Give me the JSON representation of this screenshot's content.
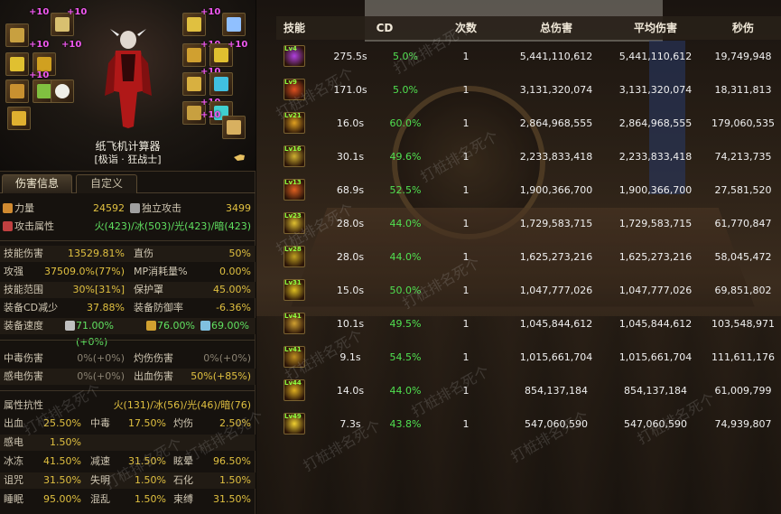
{
  "character": {
    "name": "纸飞机计算器",
    "title": "[极诣 · 狂战士]",
    "enhance_label": "+10"
  },
  "tabs": [
    {
      "label": "伤害信息",
      "active": true
    },
    {
      "label": "自定义",
      "active": false
    }
  ],
  "stats_top": {
    "strength": {
      "label": "力量",
      "value": "24592"
    },
    "indep_attack": {
      "label": "独立攻击",
      "value": "3499"
    },
    "element": {
      "label": "攻击属性",
      "value": "火(423)/冰(503)/光(423)/暗(423)"
    }
  },
  "stats_mid": [
    {
      "label_a": "技能伤害",
      "value_a": "13529.81%",
      "label_b": "直伤",
      "value_b": "50%"
    },
    {
      "label_a": "攻强",
      "value_a": "37509.0%(77%)",
      "label_b": "MP消耗量%",
      "value_b": "0.00%"
    },
    {
      "label_a": "技能范围",
      "value_a": "30%[31%]",
      "label_b": "保护罩",
      "value_b": "45.00%"
    },
    {
      "label_a": "装备CD减少",
      "value_a": "37.88%",
      "label_b": "装备防御率",
      "value_b": "-6.36%"
    }
  ],
  "equip_speed": {
    "label": "装备速度",
    "v1": "71.00%(+0%)",
    "v2": "76.00%",
    "v3": "69.00%"
  },
  "stats_status": [
    {
      "label_a": "中毒伤害",
      "value_a": "0%(+0%)",
      "label_b": "灼伤伤害",
      "value_b": "0%(+0%)"
    },
    {
      "label_a": "感电伤害",
      "value_a": "0%(+0%)",
      "label_b": "出血伤害",
      "value_b": "50%(+85%)"
    }
  ],
  "resist": {
    "label": "属性抗性",
    "value": "火(131)/冰(56)/光(46)/暗(76)"
  },
  "abnormal": [
    [
      {
        "label": "出血",
        "value": "25.50%"
      },
      {
        "label": "中毒",
        "value": "17.50%"
      },
      {
        "label": "灼伤",
        "value": "2.50%"
      }
    ],
    [
      {
        "label": "感电",
        "value": "1.50%"
      }
    ],
    [
      {
        "label": "冰冻",
        "value": "41.50%"
      },
      {
        "label": "减速",
        "value": "31.50%"
      },
      {
        "label": "眩晕",
        "value": "96.50%"
      }
    ],
    [
      {
        "label": "诅咒",
        "value": "31.50%"
      },
      {
        "label": "失明",
        "value": "1.50%"
      },
      {
        "label": "石化",
        "value": "1.50%"
      }
    ],
    [
      {
        "label": "睡眠",
        "value": "95.00%"
      },
      {
        "label": "混乱",
        "value": "1.50%"
      },
      {
        "label": "束缚",
        "value": "31.50%"
      }
    ]
  ],
  "table": {
    "headers": [
      "技能",
      "CD",
      "次数",
      "总伤害",
      "平均伤害",
      "秒伤"
    ],
    "rows": [
      {
        "lv": "Lv4",
        "cd": "275.5s",
        "pct": "5.0%",
        "count": "1",
        "total": "5,441,110,612",
        "avg": "5,441,110,612",
        "dps": "19,749,948",
        "color": "#b040e0"
      },
      {
        "lv": "Lv9",
        "cd": "171.0s",
        "pct": "5.0%",
        "count": "1",
        "total": "3,131,320,074",
        "avg": "3,131,320,074",
        "dps": "18,311,813",
        "color": "#e05020"
      },
      {
        "lv": "Lv21",
        "cd": "16.0s",
        "pct": "60.0%",
        "count": "1",
        "total": "2,864,968,555",
        "avg": "2,864,968,555",
        "dps": "179,060,535",
        "color": "#e0a020"
      },
      {
        "lv": "Lv16",
        "cd": "30.1s",
        "pct": "49.6%",
        "count": "1",
        "total": "2,233,833,418",
        "avg": "2,233,833,418",
        "dps": "74,213,735",
        "color": "#d0b030"
      },
      {
        "lv": "Lv13",
        "cd": "68.9s",
        "pct": "52.5%",
        "count": "1",
        "total": "1,900,366,700",
        "avg": "1,900,366,700",
        "dps": "27,581,520",
        "color": "#e06020"
      },
      {
        "lv": "Lv23",
        "cd": "28.0s",
        "pct": "44.0%",
        "count": "1",
        "total": "1,729,583,715",
        "avg": "1,729,583,715",
        "dps": "61,770,847",
        "color": "#e0c030"
      },
      {
        "lv": "Lv28",
        "cd": "28.0s",
        "pct": "44.0%",
        "count": "1",
        "total": "1,625,273,216",
        "avg": "1,625,273,216",
        "dps": "58,045,472",
        "color": "#c0a020"
      },
      {
        "lv": "Lv31",
        "cd": "15.0s",
        "pct": "50.0%",
        "count": "1",
        "total": "1,047,777,026",
        "avg": "1,047,777,026",
        "dps": "69,851,802",
        "color": "#e0c020"
      },
      {
        "lv": "Lv41",
        "cd": "10.1s",
        "pct": "49.5%",
        "count": "1",
        "total": "1,045,844,612",
        "avg": "1,045,844,612",
        "dps": "103,548,971",
        "color": "#d0a030"
      },
      {
        "lv": "Lv41",
        "cd": "9.1s",
        "pct": "54.5%",
        "count": "1",
        "total": "1,015,661,704",
        "avg": "1,015,661,704",
        "dps": "111,611,176",
        "color": "#c09020"
      },
      {
        "lv": "Lv44",
        "cd": "14.0s",
        "pct": "44.0%",
        "count": "1",
        "total": "854,137,184",
        "avg": "854,137,184",
        "dps": "61,009,799",
        "color": "#e0b020"
      },
      {
        "lv": "Lv49",
        "cd": "7.3s",
        "pct": "43.8%",
        "count": "1",
        "total": "547,060,590",
        "avg": "547,060,590",
        "dps": "74,939,807",
        "color": "#f0d030"
      }
    ]
  },
  "watermark": "打桩排名死个"
}
